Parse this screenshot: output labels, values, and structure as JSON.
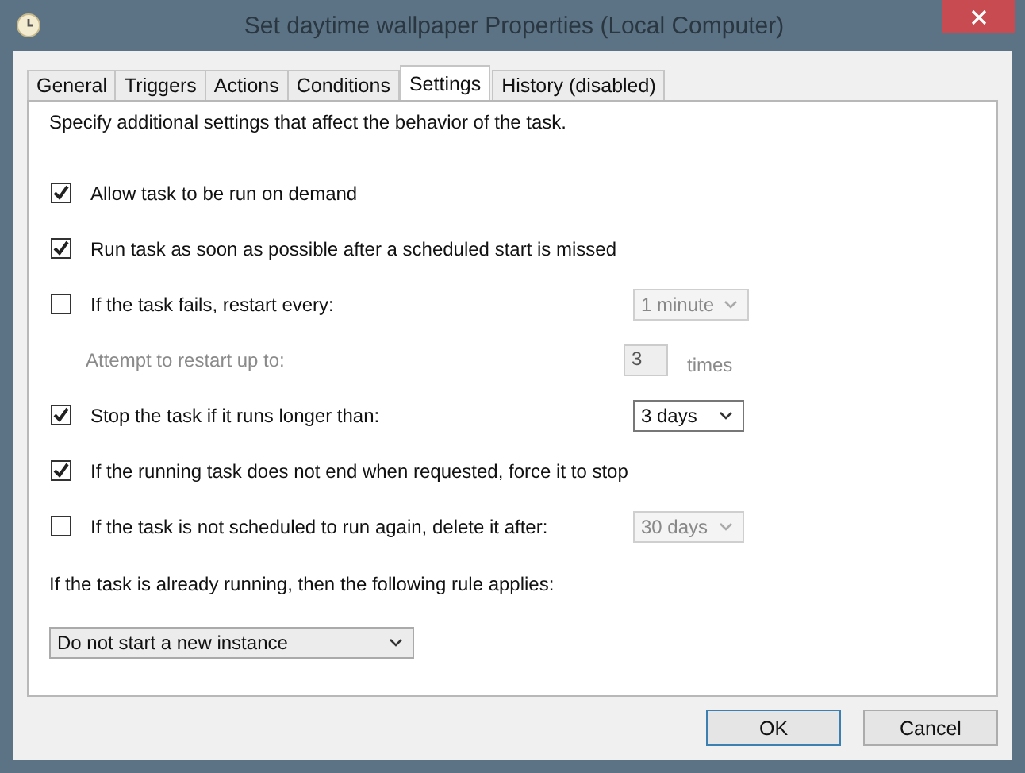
{
  "window": {
    "title": "Set daytime wallpaper Properties (Local Computer)"
  },
  "tabs": [
    {
      "label": "General",
      "selected": false
    },
    {
      "label": "Triggers",
      "selected": false
    },
    {
      "label": "Actions",
      "selected": false
    },
    {
      "label": "Conditions",
      "selected": false
    },
    {
      "label": "Settings",
      "selected": true
    },
    {
      "label": "History (disabled)",
      "selected": false
    }
  ],
  "intro": "Specify additional settings that affect the behavior of the task.",
  "settings": [
    {
      "kind": "checkbox",
      "label": "Allow task to be run on demand",
      "checked": true
    },
    {
      "kind": "checkbox",
      "label": "Run task as soon as possible after a scheduled start is missed",
      "checked": true
    },
    {
      "kind": "checkbox",
      "label": "If the task fails, restart every:",
      "checked": false,
      "dropdown": {
        "value": "1 minute",
        "disabled": true
      }
    },
    {
      "kind": "count",
      "label": "Attempt to restart up to:",
      "value": "3",
      "unit": "times",
      "disabled": true
    },
    {
      "kind": "checkbox",
      "label": "Stop the task if it runs longer than:",
      "checked": true,
      "dropdown": {
        "value": "3 days",
        "disabled": false
      }
    },
    {
      "kind": "checkbox",
      "label": "If the running task does not end when requested, force it to stop",
      "checked": true
    },
    {
      "kind": "checkbox",
      "label": "If the task is not scheduled to run again, delete it after:",
      "checked": false,
      "dropdown": {
        "value": "30 days",
        "disabled": true
      }
    }
  ],
  "rule_label": "If the task is already running, then the following rule applies:",
  "rule_dropdown": "Do not start a new instance",
  "buttons": [
    {
      "label": "OK",
      "default": true
    },
    {
      "label": "Cancel",
      "default": false
    }
  ]
}
